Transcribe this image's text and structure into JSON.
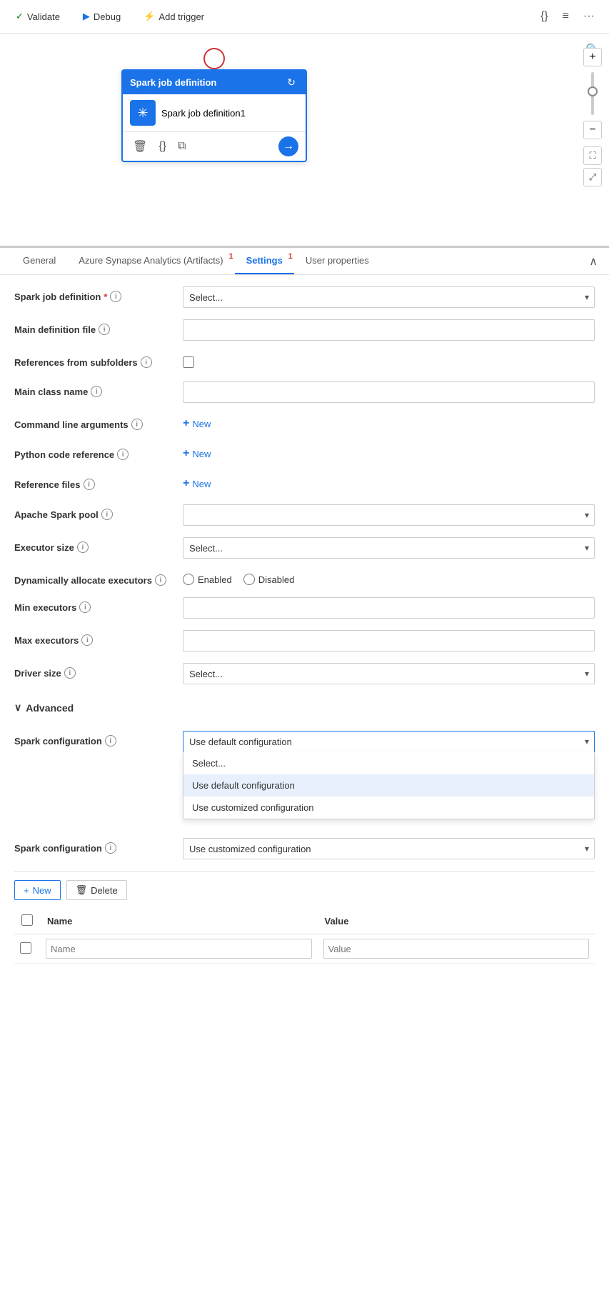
{
  "toolbar": {
    "validate_label": "Validate",
    "debug_label": "Debug",
    "add_trigger_label": "Add trigger",
    "code_icon": "{}",
    "list_icon": "≡",
    "more_icon": "···"
  },
  "canvas": {
    "node": {
      "header": "Spark job definition",
      "name": "Spark job definition1",
      "icon": "✳"
    }
  },
  "tabs": [
    {
      "id": "general",
      "label": "General",
      "badge": null,
      "active": false
    },
    {
      "id": "artifacts",
      "label": "Azure Synapse Analytics (Artifacts)",
      "badge": "1",
      "active": false
    },
    {
      "id": "settings",
      "label": "Settings",
      "badge": "1",
      "active": true
    },
    {
      "id": "user-properties",
      "label": "User properties",
      "badge": null,
      "active": false
    }
  ],
  "settings": {
    "spark_job_def_label": "Spark job definition",
    "spark_job_def_placeholder": "Select...",
    "main_def_file_label": "Main definition file",
    "main_def_file_placeholder": "",
    "refs_from_subfolders_label": "References from subfolders",
    "main_class_name_label": "Main class name",
    "main_class_name_placeholder": "",
    "cmd_args_label": "Command line arguments",
    "cmd_args_new": "New",
    "python_code_ref_label": "Python code reference",
    "python_code_ref_new": "New",
    "ref_files_label": "Reference files",
    "ref_files_new": "New",
    "apache_spark_pool_label": "Apache Spark pool",
    "apache_spark_pool_placeholder": "",
    "executor_size_label": "Executor size",
    "executor_size_placeholder": "Select...",
    "dyn_alloc_label": "Dynamically allocate executors",
    "enabled_label": "Enabled",
    "disabled_label": "Disabled",
    "min_executors_label": "Min executors",
    "min_executors_placeholder": "",
    "max_executors_label": "Max executors",
    "max_executors_placeholder": "",
    "driver_size_label": "Driver size",
    "driver_size_placeholder": "Select...",
    "advanced_label": "Advanced",
    "spark_config_label": "Spark configuration",
    "spark_config_value": "Use default configuration",
    "spark_config_options": [
      {
        "value": "select",
        "label": "Select..."
      },
      {
        "value": "default",
        "label": "Use default configuration"
      },
      {
        "value": "custom",
        "label": "Use customized configuration"
      }
    ],
    "spark_config2_label": "Spark configuration",
    "spark_config2_value": "Use customized configuration",
    "new_label": "New",
    "delete_label": "Delete",
    "col_name": "Name",
    "col_value": "Value",
    "name_placeholder": "Name",
    "value_placeholder": "Value"
  }
}
